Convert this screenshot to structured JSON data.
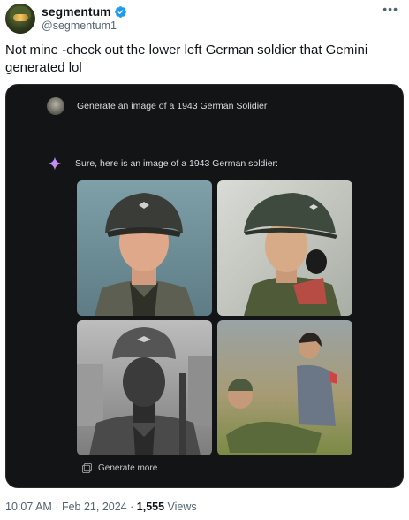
{
  "author": {
    "display_name": "segmentum",
    "handle": "@segmentum1"
  },
  "tweet": {
    "text": "Not mine -check out the lower left German soldier that Gemini generated lol"
  },
  "gemini": {
    "prompt": "Generate an image of a 1943 German Solidier",
    "response": "Sure, here is an image of a 1943 German soldier:",
    "generate_more_label": "Generate more"
  },
  "meta": {
    "time": "10:07 AM",
    "separator": "·",
    "date": "Feb 21, 2024",
    "views_count": "1,555",
    "views_label": "Views"
  },
  "icons": {
    "verified": "verified-badge-icon",
    "more": "more-options-icon",
    "sparkle": "gemini-sparkle-icon",
    "generate_more": "generate-more-icon"
  },
  "colors": {
    "verified_blue": "#1d9bf0",
    "card_bg": "#131416",
    "secondary_text": "#536471"
  }
}
